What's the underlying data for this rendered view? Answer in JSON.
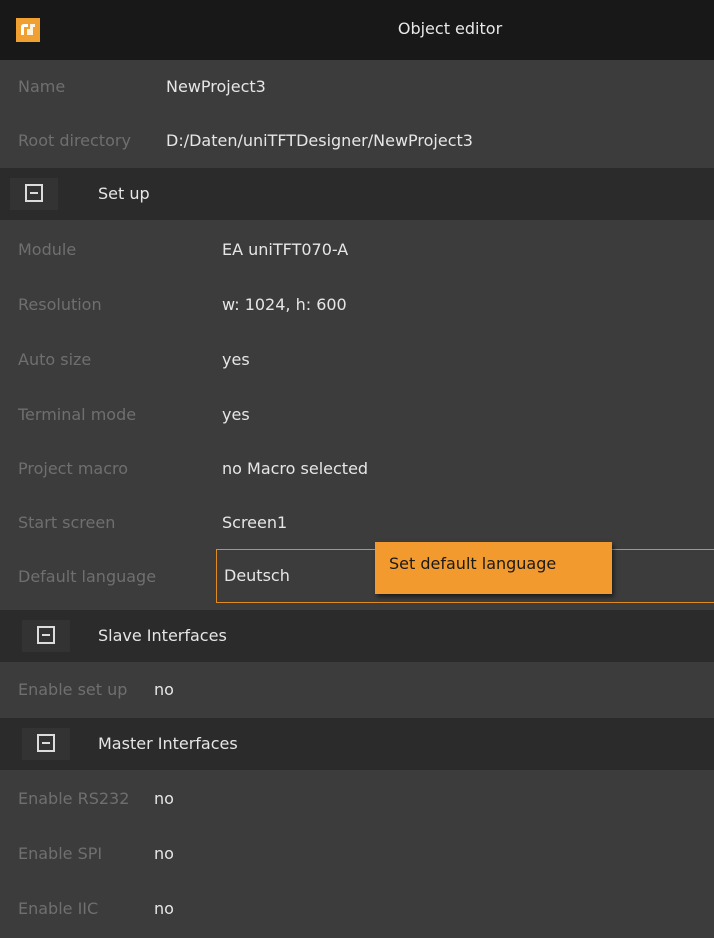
{
  "window": {
    "title": "Object editor",
    "app_icon": "uniTFT-designer-icon"
  },
  "project": {
    "name_label": "Name",
    "name_value": "NewProject3",
    "root_label": "Root directory",
    "root_value": "D:/Daten/uniTFTDesigner/NewProject3"
  },
  "setup": {
    "header": "Set up",
    "collapse_icon": "collapse-minus-icon",
    "module_label": "Module",
    "module_value": "EA uniTFT070-A",
    "resolution_label": "Resolution",
    "resolution_value": "w: 1024,  h: 600",
    "autosize_label": "Auto size",
    "autosize_value": "yes",
    "terminal_label": "Terminal mode",
    "terminal_value": "yes",
    "macro_label": "Project macro",
    "macro_value": "no Macro selected",
    "start_label": "Start screen",
    "start_value": "Screen1",
    "language_label": "Default language",
    "language_value": "Deutsch",
    "language_tooltip": "Set default language"
  },
  "slave": {
    "header": "Slave Interfaces",
    "enable_label": "Enable set up",
    "enable_value": "no"
  },
  "master": {
    "header": "Master Interfaces",
    "rs232_label": "Enable RS232",
    "rs232_value": "no",
    "spi_label": "Enable SPI",
    "spi_value": "no",
    "iic_label": "Enable IIC",
    "iic_value": "no"
  },
  "colors": {
    "accent": "#f29a2e",
    "background": "#3c3c3c",
    "header": "#2b2b2b",
    "titlebar": "#181818"
  }
}
